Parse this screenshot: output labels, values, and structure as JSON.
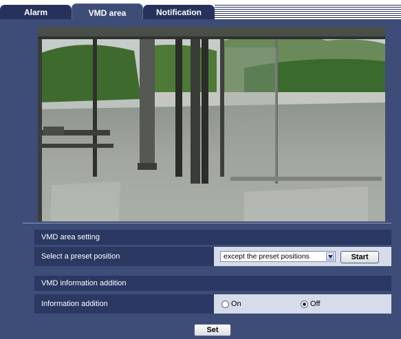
{
  "tabs": [
    {
      "label": "Alarm",
      "active": false
    },
    {
      "label": "VMD area",
      "active": true
    },
    {
      "label": "Notification",
      "active": false
    }
  ],
  "video": {
    "description_icon": "camera-live-view"
  },
  "vmd_area_setting": {
    "heading": "VMD area setting",
    "preset_label": "Select a preset position",
    "preset_value": "except the preset positions",
    "start_label": "Start"
  },
  "vmd_information": {
    "heading": "VMD information addition",
    "info_label": "Information addition",
    "on_label": "On",
    "off_label": "Off",
    "selected": "Off"
  },
  "set_label": "Set",
  "colors": {
    "panel": "#3d4d78",
    "tab_inactive": "#26315c",
    "row_dark": "#2b3862",
    "row_value": "#d6dce9"
  }
}
